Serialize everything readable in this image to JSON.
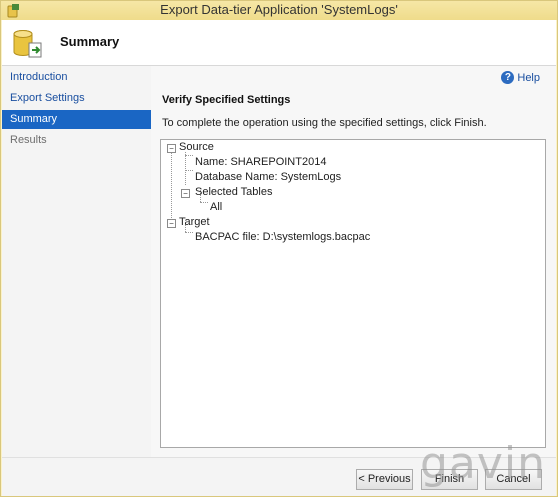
{
  "window": {
    "title": "Export Data-tier Application 'SystemLogs'"
  },
  "header": {
    "title": "Summary"
  },
  "nav": {
    "items": [
      {
        "label": "Introduction",
        "state": "link"
      },
      {
        "label": "Export Settings",
        "state": "link"
      },
      {
        "label": "Summary",
        "state": "selected"
      },
      {
        "label": "Results",
        "state": "disabled"
      }
    ]
  },
  "content": {
    "help_label": "Help",
    "section_title": "Verify Specified Settings",
    "instructions": "To complete the operation using the specified settings, click Finish.",
    "tree": {
      "source_label": "Source",
      "name": "Name: SHAREPOINT2014",
      "database": "Database Name: SystemLogs",
      "selected_tables": "Selected Tables",
      "all": "All",
      "target_label": "Target",
      "bacpac": "BACPAC file: D:\\systemlogs.bacpac"
    }
  },
  "footer": {
    "previous_label": "< Previous",
    "finish_label": "Finish",
    "cancel_label": "Cancel"
  },
  "watermark": "gavin",
  "colors": {
    "accent": "#1a66c4",
    "link": "#1a4fa0"
  }
}
